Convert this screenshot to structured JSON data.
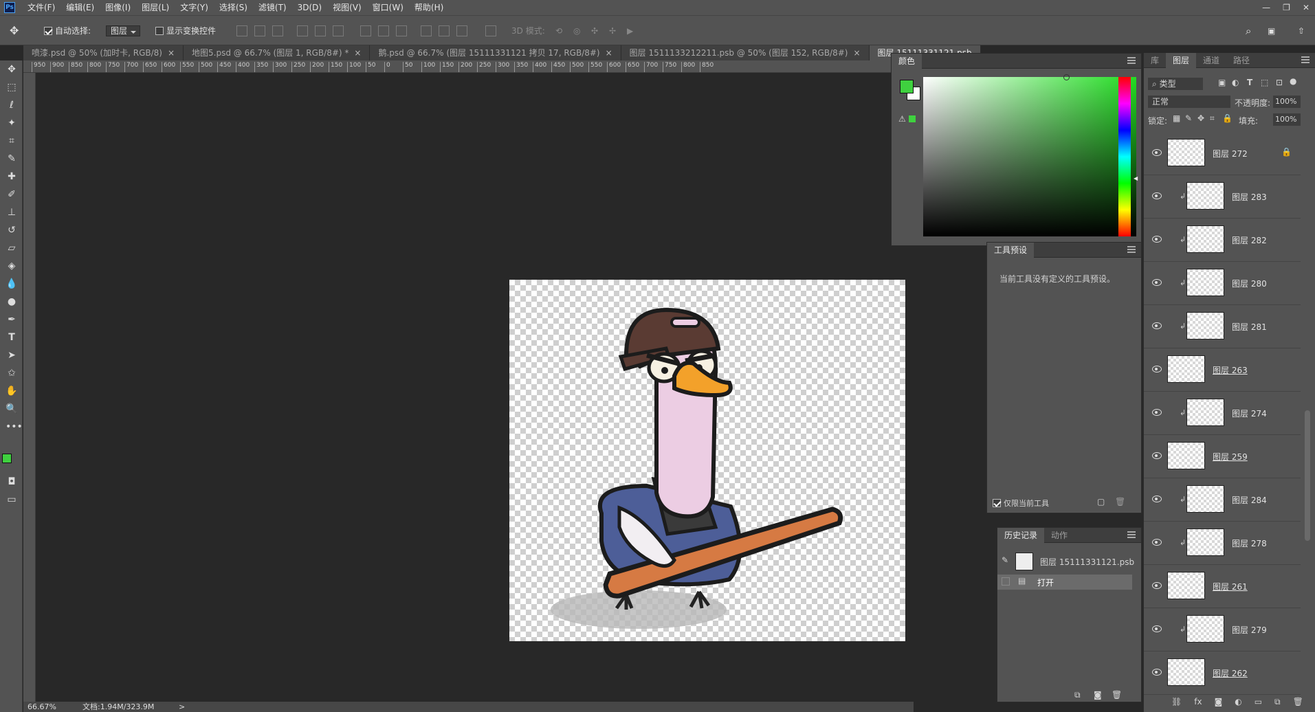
{
  "app": {
    "logo": "Ps",
    "menu": [
      "文件(F)",
      "编辑(E)",
      "图像(I)",
      "图层(L)",
      "文字(Y)",
      "选择(S)",
      "滤镜(T)",
      "3D(D)",
      "视图(V)",
      "窗口(W)",
      "帮助(H)"
    ]
  },
  "options": {
    "auto_select_label": "自动选择:",
    "auto_select_value": "图层",
    "show_transform_label": "显示变换控件",
    "mode3d": "3D 模式:"
  },
  "tabs": [
    {
      "label": "喷漆.psd @ 50% (加时卡, RGB/8)",
      "close": "×"
    },
    {
      "label": "地图5.psd @ 66.7% (图层 1, RGB/8#) *",
      "close": "×"
    },
    {
      "label": "鹅.psd @ 66.7% (图层 15111331121 拷贝 17, RGB/8#)",
      "close": "×"
    },
    {
      "label": "图层 1511133212211.psb @ 50% (图层 152, RGB/8#)",
      "close": "×"
    },
    {
      "label": "图层 15111331121.psb",
      "close": ""
    }
  ],
  "ruler": [
    "950",
    "900",
    "850",
    "800",
    "750",
    "700",
    "650",
    "600",
    "550",
    "500",
    "450",
    "400",
    "350",
    "300",
    "250",
    "200",
    "150",
    "100",
    "50",
    "0",
    "50",
    "100",
    "150",
    "200",
    "250",
    "300",
    "350",
    "400",
    "450",
    "500",
    "550",
    "600",
    "650",
    "700",
    "750",
    "800",
    "850"
  ],
  "status": {
    "zoom": "66.67%",
    "doc": "文档:1.94M/323.9M",
    "arrow": ">"
  },
  "color_panel": {
    "title": "颜色",
    "fg": "#3fd13f",
    "bg": "#ffffff",
    "hue": "#22dd22"
  },
  "tool_preset": {
    "title": "工具预设",
    "empty": "当前工具没有定义的工具预设。",
    "only_current": "仅限当前工具"
  },
  "history": {
    "tabs": [
      "历史记录",
      "动作"
    ],
    "snapshot": "图层 15111331121.psb",
    "items": [
      "打开"
    ]
  },
  "layers_panel": {
    "tabs": [
      "库",
      "图层",
      "通道",
      "路径"
    ],
    "filter": "类型",
    "blend": "正常",
    "opacity_label": "不透明度:",
    "opacity": "100%",
    "lock_label": "锁定:",
    "fill_label": "填充:",
    "fill": "100%",
    "layers": [
      {
        "name": "图层 272",
        "clip": false,
        "underline": false,
        "locked": true
      },
      {
        "name": "图层 283",
        "clip": true,
        "underline": false,
        "locked": false
      },
      {
        "name": "图层 282",
        "clip": true,
        "underline": false,
        "locked": false
      },
      {
        "name": "图层 280",
        "clip": true,
        "underline": false,
        "locked": false
      },
      {
        "name": "图层 281",
        "clip": true,
        "underline": false,
        "locked": false
      },
      {
        "name": "图层 263",
        "clip": false,
        "underline": true,
        "locked": false
      },
      {
        "name": "图层 274",
        "clip": true,
        "underline": false,
        "locked": false
      },
      {
        "name": "图层 259",
        "clip": false,
        "underline": true,
        "locked": false
      },
      {
        "name": "图层 284",
        "clip": true,
        "underline": false,
        "locked": false
      },
      {
        "name": "图层 278",
        "clip": true,
        "underline": false,
        "locked": false
      },
      {
        "name": "图层 261",
        "clip": false,
        "underline": true,
        "locked": false
      },
      {
        "name": "图层 279",
        "clip": true,
        "underline": false,
        "locked": false
      },
      {
        "name": "图层 262",
        "clip": false,
        "underline": true,
        "locked": false
      }
    ]
  }
}
